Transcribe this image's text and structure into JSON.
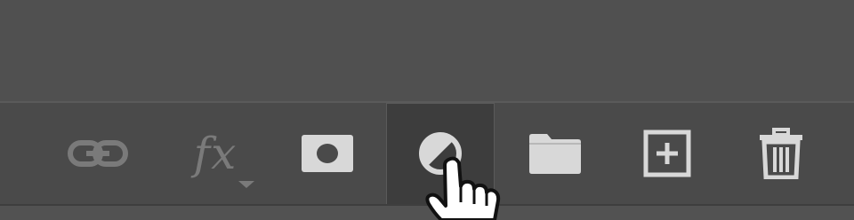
{
  "layers_panel": {
    "toolbar": {
      "buttons": [
        {
          "name": "link-layers",
          "icon": "link-icon",
          "enabled": false
        },
        {
          "name": "layer-style",
          "icon": "fx-icon",
          "label": "fx",
          "enabled": false,
          "has_dropdown": true
        },
        {
          "name": "add-layer-mask",
          "icon": "mask-icon",
          "enabled": true
        },
        {
          "name": "new-adjustment-layer",
          "icon": "adjustment-circle-icon",
          "enabled": true,
          "state": "hovered"
        },
        {
          "name": "new-group",
          "icon": "folder-icon",
          "enabled": true
        },
        {
          "name": "new-layer",
          "icon": "plus-square-icon",
          "enabled": true
        },
        {
          "name": "delete-layer",
          "icon": "trash-icon",
          "enabled": true
        }
      ]
    },
    "cursor": {
      "icon": "hand-pointer-icon"
    }
  },
  "colors": {
    "panel_bg": "#505050",
    "toolbar_bg": "#4a4a4a",
    "active_bg": "#3d3d3d",
    "icon_enabled": "#d8d8d8",
    "icon_disabled": "#7a7a7a"
  }
}
